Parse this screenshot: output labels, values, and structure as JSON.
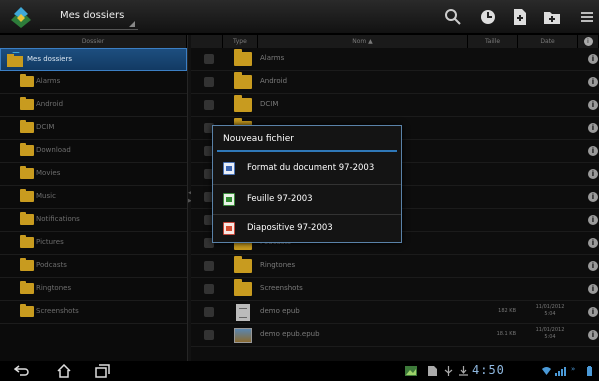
{
  "actionbar": {
    "title": "Mes dossiers",
    "icons": [
      "search-icon",
      "recent-icon",
      "new-file-icon",
      "new-folder-icon",
      "menu-icon"
    ]
  },
  "columns": {
    "dossier": "Dossier",
    "type": "Type",
    "nom": "Nom ▲",
    "taille": "Taille",
    "date": "Date"
  },
  "tree": {
    "items": [
      {
        "label": "Mes dossiers",
        "selected": true
      },
      {
        "label": "Alarms"
      },
      {
        "label": "Android"
      },
      {
        "label": "DCIM"
      },
      {
        "label": "Download"
      },
      {
        "label": "Movies"
      },
      {
        "label": "Music"
      },
      {
        "label": "Notifications"
      },
      {
        "label": "Pictures"
      },
      {
        "label": "Podcasts"
      },
      {
        "label": "Ringtones"
      },
      {
        "label": "Screenshots"
      }
    ]
  },
  "files": [
    {
      "name": "Alarms",
      "type": "folder",
      "size": "",
      "date": "",
      "time": ""
    },
    {
      "name": "Android",
      "type": "folder",
      "size": "",
      "date": "",
      "time": ""
    },
    {
      "name": "DCIM",
      "type": "folder",
      "size": "",
      "date": "",
      "time": ""
    },
    {
      "name": "",
      "type": "folder",
      "size": "",
      "date": "",
      "time": ""
    },
    {
      "name": "",
      "type": "folder",
      "size": "",
      "date": "",
      "time": ""
    },
    {
      "name": "",
      "type": "folder",
      "size": "",
      "date": "",
      "time": ""
    },
    {
      "name": "",
      "type": "folder",
      "size": "",
      "date": "",
      "time": ""
    },
    {
      "name": "",
      "type": "folder",
      "size": "",
      "date": "",
      "time": ""
    },
    {
      "name": "Podcasts",
      "type": "folder",
      "size": "",
      "date": "",
      "time": ""
    },
    {
      "name": "Ringtones",
      "type": "folder",
      "size": "",
      "date": "",
      "time": ""
    },
    {
      "name": "Screenshots",
      "type": "folder",
      "size": "",
      "date": "",
      "time": ""
    },
    {
      "name": "demo epub",
      "type": "doc",
      "size": "182 KB",
      "date": "11/01/2012",
      "time": "5:04"
    },
    {
      "name": "demo epub.epub",
      "type": "image",
      "size": "18.1 KB",
      "date": "11/01/2012",
      "time": "5:04"
    }
  ],
  "dialog": {
    "title": "Nouveau fichier",
    "options": [
      {
        "label": "Format du document 97-2003",
        "icon": "word-doc-icon"
      },
      {
        "label": "Feuille 97-2003",
        "icon": "excel-sheet-icon"
      },
      {
        "label": "Diapositive 97-2003",
        "icon": "powerpoint-slide-icon"
      }
    ]
  },
  "systembar": {
    "clock": "4:50",
    "nav": [
      "back-icon",
      "home-icon",
      "recent-apps-icon"
    ]
  },
  "colors": {
    "accent": "#2f78b8",
    "folder": "#c89b1f",
    "clock": "#8fb8e0"
  }
}
